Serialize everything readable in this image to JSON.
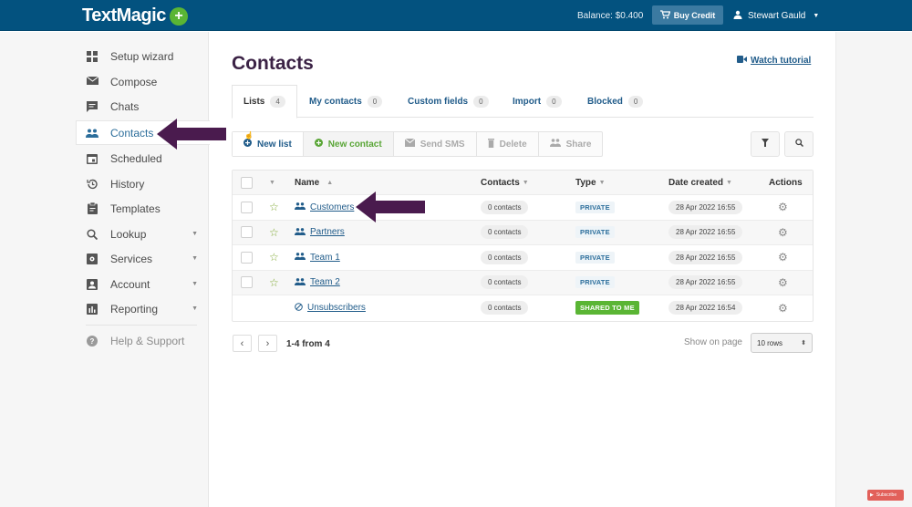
{
  "header": {
    "logo": "TextMagic",
    "logo_plus": "+",
    "balance": "Balance: $0.400",
    "buy_credit": "Buy Credit",
    "user_name": "Stewart Gauld"
  },
  "sidebar": {
    "items": [
      {
        "label": "Setup wizard",
        "icon": "grid-icon"
      },
      {
        "label": "Compose",
        "icon": "compose-icon"
      },
      {
        "label": "Chats",
        "icon": "chat-icon"
      },
      {
        "label": "Contacts",
        "icon": "contacts-icon",
        "active": true
      },
      {
        "label": "Scheduled",
        "icon": "calendar-icon"
      },
      {
        "label": "History",
        "icon": "history-icon"
      },
      {
        "label": "Templates",
        "icon": "clipboard-icon"
      },
      {
        "label": "Lookup",
        "icon": "search-icon",
        "dropdown": true
      },
      {
        "label": "Services",
        "icon": "services-icon",
        "dropdown": true
      },
      {
        "label": "Account",
        "icon": "account-icon",
        "dropdown": true
      },
      {
        "label": "Reporting",
        "icon": "chart-icon",
        "dropdown": true
      }
    ],
    "help": {
      "label": "Help & Support",
      "icon": "help-icon"
    }
  },
  "main": {
    "title": "Contacts",
    "watch_tutorial": "Watch tutorial",
    "tabs": [
      {
        "label": "Lists",
        "count": "4",
        "active": true
      },
      {
        "label": "My contacts",
        "count": "0"
      },
      {
        "label": "Custom fields",
        "count": "0"
      },
      {
        "label": "Import",
        "count": "0"
      },
      {
        "label": "Blocked",
        "count": "0"
      }
    ],
    "toolbar": {
      "new_list": "New list",
      "new_contact": "New contact",
      "send_sms": "Send SMS",
      "delete": "Delete",
      "share": "Share"
    },
    "table": {
      "columns": {
        "name": "Name",
        "contacts": "Contacts",
        "type": "Type",
        "date_created": "Date created",
        "actions": "Actions"
      },
      "rows": [
        {
          "name": "Customers",
          "contacts": "0 contacts",
          "type": "PRIVATE",
          "date": "28 Apr 2022 16:55"
        },
        {
          "name": "Partners",
          "contacts": "0 contacts",
          "type": "PRIVATE",
          "date": "28 Apr 2022 16:55"
        },
        {
          "name": "Team 1",
          "contacts": "0 contacts",
          "type": "PRIVATE",
          "date": "28 Apr 2022 16:55"
        },
        {
          "name": "Team 2",
          "contacts": "0 contacts",
          "type": "PRIVATE",
          "date": "28 Apr 2022 16:55"
        },
        {
          "name": "Unsubscribers",
          "contacts": "0 contacts",
          "type": "SHARED TO ME",
          "date": "28 Apr 2022 16:54"
        }
      ]
    },
    "pagination": {
      "range": "1-4 from 4",
      "show_on_page": "Show on page",
      "rows_per_page": "10 rows"
    }
  },
  "overlay": {
    "subscribe": "Subscribe"
  },
  "colors": {
    "topbar": "#03527f",
    "accent_blue": "#215c8a",
    "green": "#5ab534",
    "arrow": "#4a1b4e",
    "title": "#3b2245"
  }
}
